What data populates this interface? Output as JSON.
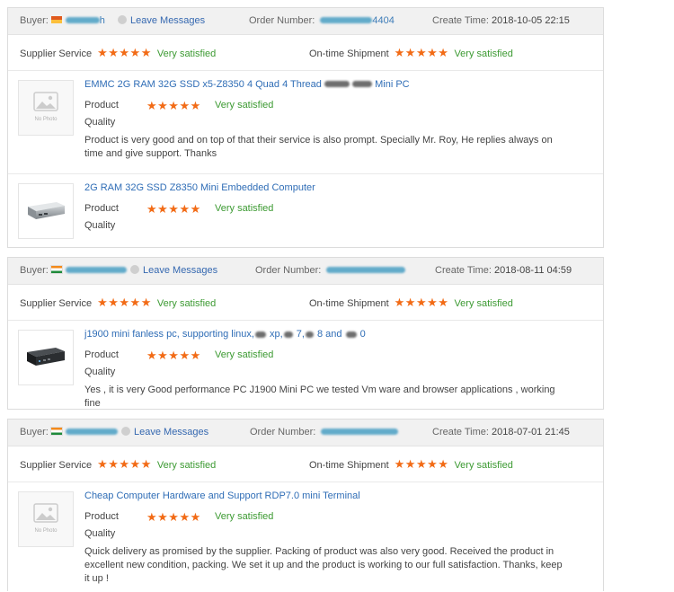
{
  "labels": {
    "buyer": "Buyer:",
    "leave_messages": "Leave Messages",
    "order_number": "Order Number:",
    "create_time": "Create Time:",
    "supplier_service": "Supplier Service",
    "ontime_shipment": "On-time Shipment",
    "product": "Product",
    "quality": "Quality",
    "no_photo": "No Photo"
  },
  "stars": "★★★★★",
  "colors": {
    "star": "#f26b16",
    "verdict": "#3c9a32",
    "link": "#2f6db6",
    "header_bg": "#f1f1f1"
  },
  "reviews": [
    {
      "buyer_flag": "philippines-flag",
      "buyer_visible_fragment": "h",
      "order_visible_fragment": "4404",
      "create_time": "2018-10-05 22:15",
      "supplier_service": "Very satisfied",
      "ontime_shipment": "Very satisfied",
      "products": [
        {
          "title": "EMMC 2G RAM 32G SSD x5-Z8350 4 Quad 4 Thread Mini PC",
          "product_rating": "Very satisfied",
          "image": "no-photo-icon",
          "comment": "Product is very good and on top of that their service is also prompt. Specially Mr. Roy, He replies always on time and give support. Thanks"
        },
        {
          "title": "2G RAM 32G SSD Z8350 Mini Embedded Computer",
          "product_rating": "Very satisfied",
          "image": "mini-pc-silver-image"
        }
      ]
    },
    {
      "buyer_flag": "india-flag",
      "create_time": "2018-08-11 04:59",
      "supplier_service": "Very satisfied",
      "ontime_shipment": "Very satisfied",
      "products": [
        {
          "title": "j1900 mini fanless pc, supporting linux, xp, 7, 8 and 0",
          "product_rating": "Very satisfied",
          "image": "mini-pc-black-image",
          "comment": "Yes , it is very Good performance PC J1900 Mini PC we tested Vm ware and browser applications , working fine"
        }
      ]
    },
    {
      "buyer_flag": "india-flag",
      "create_time": "2018-07-01 21:45",
      "supplier_service": "Very satisfied",
      "ontime_shipment": "Very satisfied",
      "products": [
        {
          "title": "Cheap Computer Hardware and Support RDP7.0 mini Terminal",
          "product_rating": "Very satisfied",
          "image": "no-photo-icon",
          "comment": "Quick delivery as promised by the supplier. Packing of product was also very good. Received the product in excellent new condition, packing. We set it up and the product is working to our full satisfaction. Thanks, keep it up !"
        }
      ]
    }
  ]
}
